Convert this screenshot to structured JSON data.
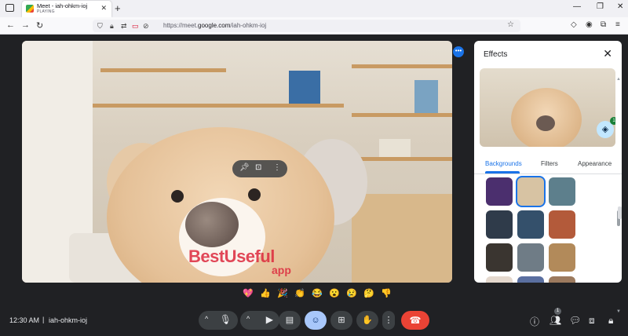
{
  "browser": {
    "tab_title": "Meet - iah-ohkm-ioj",
    "tab_status": "PLAYING",
    "url_prefix": "https://meet.",
    "url_domain": "google.com",
    "url_path": "/iah-ohkm-ioj"
  },
  "video": {
    "watermark_main": "BestUseful",
    "watermark_sub": "app"
  },
  "effects_panel": {
    "title": "Effects",
    "layers_badge": "1",
    "tabs": [
      {
        "label": "Backgrounds",
        "active": true
      },
      {
        "label": "Filters",
        "active": false
      },
      {
        "label": "Appearance",
        "active": false
      }
    ],
    "thumbnails": [
      {
        "color": "#4b2f6e",
        "selected": false
      },
      {
        "color": "#d7c3a3",
        "selected": true
      },
      {
        "color": "#5d7f8c",
        "selected": false
      },
      {
        "color": "#2f3b4a",
        "selected": false
      },
      {
        "color": "#34506b",
        "selected": false
      },
      {
        "color": "#b35a3a",
        "selected": false
      },
      {
        "color": "#3a3530",
        "selected": false
      },
      {
        "color": "#6f7c86",
        "selected": false
      },
      {
        "color": "#b28a5a",
        "selected": false
      },
      {
        "color": "#e4d8cd",
        "selected": false
      },
      {
        "color": "#5a6fa0",
        "selected": false
      },
      {
        "color": "#9c7a5e",
        "selected": false
      }
    ]
  },
  "reactions": [
    "💖",
    "👍",
    "🎉",
    "👏",
    "😂",
    "😮",
    "😢",
    "🤔",
    "👎"
  ],
  "bottom_bar": {
    "time": "12:30 AM",
    "separator": "|",
    "meeting_code": "iah-ohkm-ioj",
    "people_count": "1"
  },
  "colors": {
    "meet_bg": "#202124",
    "control_bg": "#3c4043",
    "active_control": "#a8c7fa",
    "end_call": "#ea4335",
    "accent": "#1a73e8"
  }
}
